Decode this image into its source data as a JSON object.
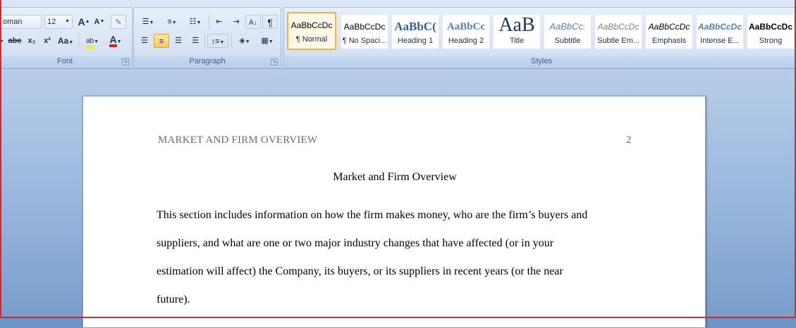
{
  "ribbon": {
    "font": {
      "label": "Font",
      "font_name": "oman",
      "font_size": "12",
      "grow_button": "A",
      "shrink_button": "A",
      "strike": "abe",
      "subscript": "x₂",
      "superscript": "x²",
      "change_case": "Aa",
      "highlight": "ab",
      "font_color": "A"
    },
    "paragraph": {
      "label": "Paragraph",
      "pilcrow": "¶"
    },
    "styles": {
      "label": "Styles",
      "items": [
        {
          "sample": "AaBbCcDc",
          "name": "¶ Normal"
        },
        {
          "sample": "AaBbCcDc",
          "name": "¶ No Spaci..."
        },
        {
          "sample": "AaBbC(",
          "name": "Heading 1"
        },
        {
          "sample": "AaBbCc",
          "name": "Heading 2"
        },
        {
          "sample": "AaB",
          "name": "Title"
        },
        {
          "sample": "AaBbCc.",
          "name": "Subtitle"
        },
        {
          "sample": "AaBbCcDc",
          "name": "Subtle Em..."
        },
        {
          "sample": "AaBbCcDc",
          "name": "Emphasis"
        },
        {
          "sample": "AaBbCcDc",
          "name": "Intense E..."
        },
        {
          "sample": "AaBbCcDc",
          "name": "Strong"
        }
      ]
    }
  },
  "document": {
    "header_left": "MARKET  AND FIRM  OVERVIEW",
    "header_page_number": "2",
    "title": "Market and Firm Overview",
    "lines": [
      "This section includes information on how the firm makes money, who are the firm’s buyers and",
      "suppliers, and what are one or two major industry changes that have affected (or in your",
      "estimation will affect) the Company, its buyers, or its suppliers in recent years (or the near",
      "future)."
    ]
  }
}
